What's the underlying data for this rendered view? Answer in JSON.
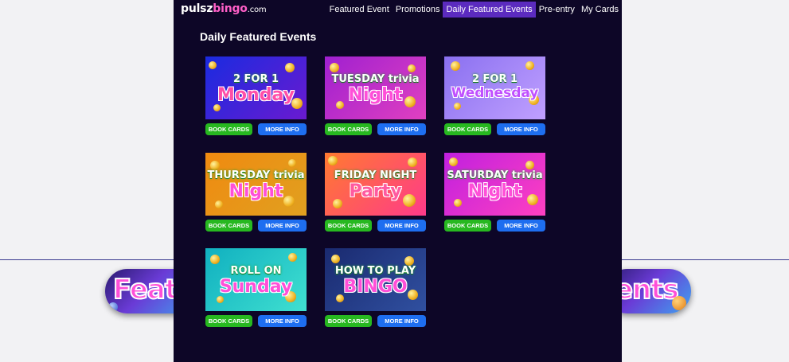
{
  "site": {
    "logo_main": "pulsz",
    "logo_accent": "bingo",
    "logo_domain": ".com"
  },
  "nav": {
    "items": [
      {
        "label": "Featured Event"
      },
      {
        "label": "Promotions"
      },
      {
        "label": "Daily Featured Events",
        "active": true
      },
      {
        "label": "Pre-entry"
      },
      {
        "label": "My Cards"
      }
    ]
  },
  "page": {
    "heading": "Daily Featured Events"
  },
  "buttons": {
    "book": "BOOK CARDS",
    "info": "MORE INFO"
  },
  "events": [
    {
      "line1": "2 FOR 1",
      "line2": "Monday",
      "accent": "#ff4fa8",
      "bg_from": "#1a2be0",
      "bg_to": "#6a1ad0"
    },
    {
      "line1": "TUESDAY trivia",
      "line2": "Night",
      "accent": "#ff4fd8",
      "bg_from": "#a020d0",
      "bg_to": "#e040c0"
    },
    {
      "line1": "2 FOR 1",
      "line2": "Wednesday",
      "accent": "#c050ff",
      "bg_from": "#8a70f0",
      "bg_to": "#c0a0ff"
    },
    {
      "line1": "THURSDAY trivia",
      "line2": "Night",
      "accent": "#ff4fd8",
      "bg_from": "#f08a10",
      "bg_to": "#e0a020"
    },
    {
      "line1": "FRIDAY NIGHT",
      "line2": "Party",
      "accent": "#ff5aa0",
      "bg_from": "#ff7a30",
      "bg_to": "#ff3a8a"
    },
    {
      "line1": "SATURDAY trivia",
      "line2": "Night",
      "accent": "#ff4fd8",
      "bg_from": "#c020e0",
      "bg_to": "#ff40c0"
    },
    {
      "line1": "ROLL ON",
      "line2": "Sunday",
      "accent": "#ff4fd8",
      "bg_from": "#10b0c0",
      "bg_to": "#40e0d0"
    },
    {
      "line1": "HOW TO PLAY",
      "line2": "BINGO",
      "accent": "#ff4fd8",
      "bg_from": "#1a2a70",
      "bg_to": "#3050a0"
    }
  ],
  "background": {
    "banner_left_text": "Featu",
    "banner_right_text": "ents"
  }
}
